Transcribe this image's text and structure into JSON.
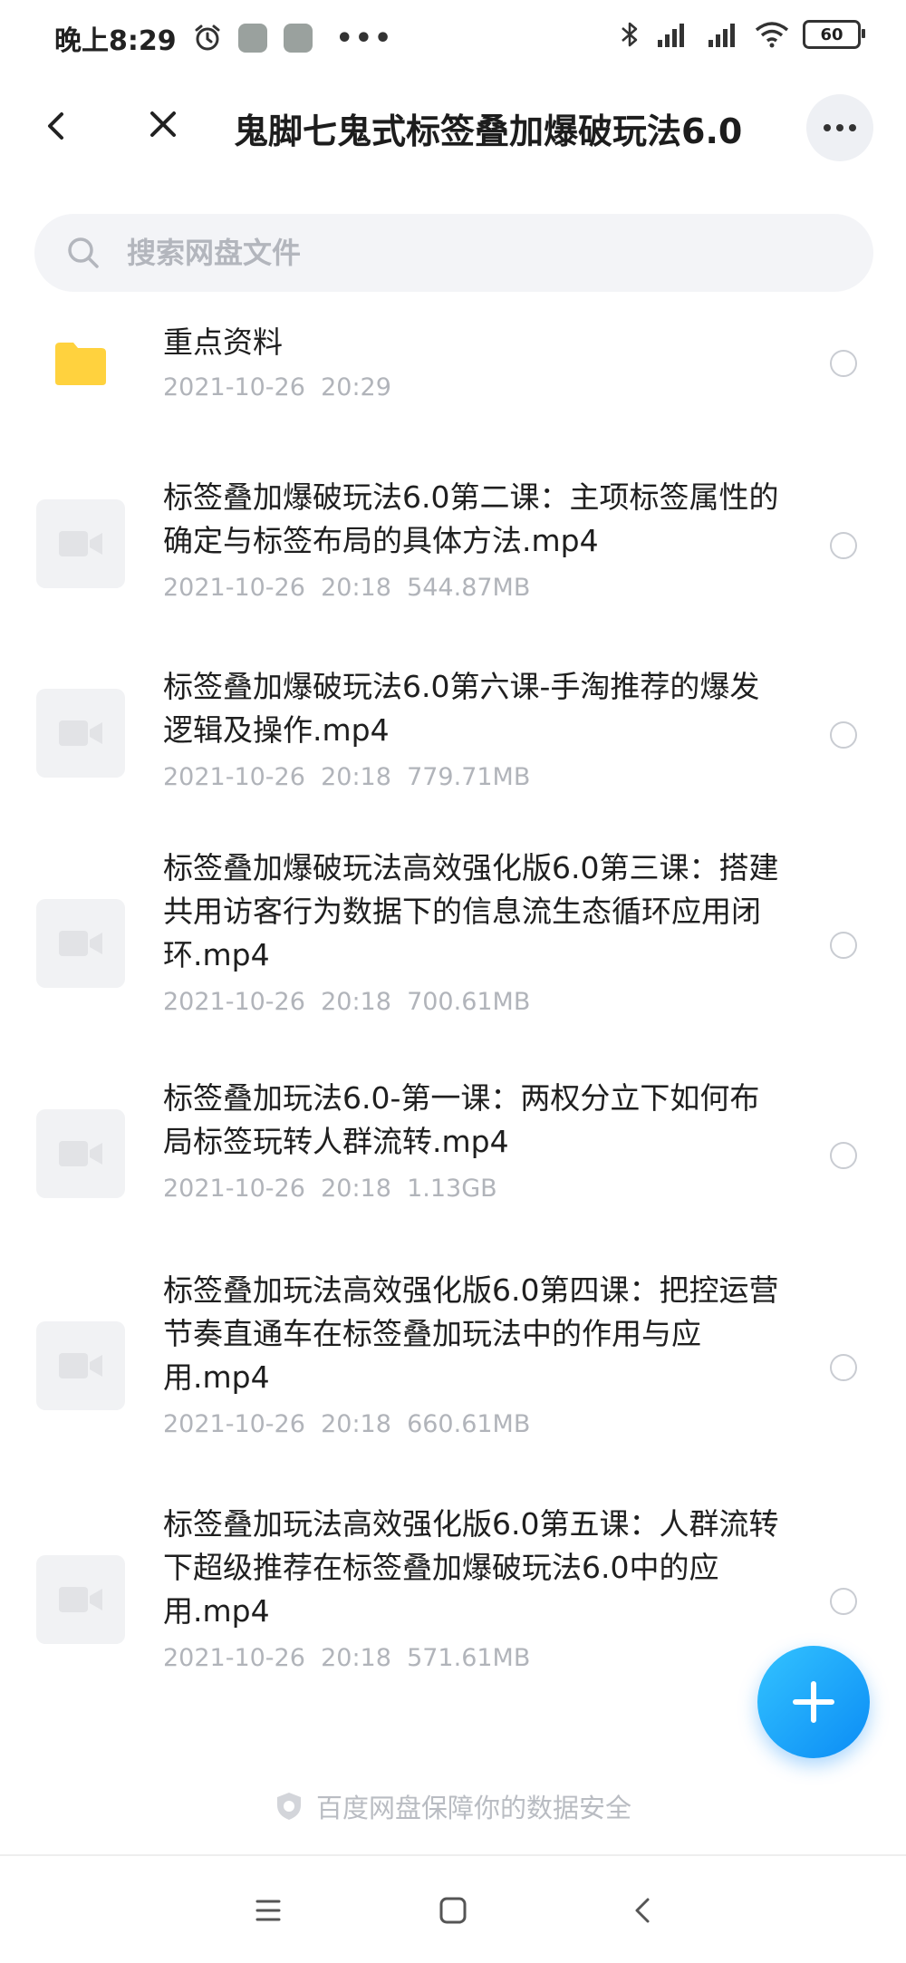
{
  "status_bar": {
    "time": "晚上8:29",
    "dots": "•••",
    "battery": "60",
    "icons": [
      "alarm-icon",
      "wechat-icon",
      "wechat-icon",
      "bluetooth-icon",
      "signal-hd-icon",
      "signal-hd-icon",
      "wifi-icon",
      "battery-icon"
    ]
  },
  "header": {
    "title": "鬼脚七鬼式标签叠加爆破玩法6.0"
  },
  "search": {
    "placeholder": "搜索网盘文件"
  },
  "files": [
    {
      "type": "folder",
      "name": "重点资料",
      "date": "2021-10-26",
      "time": "20:29",
      "size": ""
    },
    {
      "type": "video",
      "name": "标签叠加爆破玩法6.0第二课：主项标签属性的确定与标签布局的具体方法.mp4",
      "date": "2021-10-26",
      "time": "20:18",
      "size": "544.87MB"
    },
    {
      "type": "video",
      "name": "标签叠加爆破玩法6.0第六课-手淘推荐的爆发逻辑及操作.mp4",
      "date": "2021-10-26",
      "time": "20:18",
      "size": "779.71MB"
    },
    {
      "type": "video",
      "name": "标签叠加爆破玩法高效强化版6.0第三课：搭建共用访客行为数据下的信息流生态循环应用闭环.mp4",
      "date": "2021-10-26",
      "time": "20:18",
      "size": "700.61MB"
    },
    {
      "type": "video",
      "name": "标签叠加玩法6.0-第一课：两权分立下如何布局标签玩转人群流转.mp4",
      "date": "2021-10-26",
      "time": "20:18",
      "size": "1.13GB"
    },
    {
      "type": "video",
      "name": "标签叠加玩法高效强化版6.0第四课：把控运营节奏直通车在标签叠加玩法中的作用与应用.mp4",
      "date": "2021-10-26",
      "time": "20:18",
      "size": "660.61MB"
    },
    {
      "type": "video",
      "name": "标签叠加玩法高效强化版6.0第五课：人群流转下超级推荐在标签叠加爆破玩法6.0中的应用.mp4",
      "date": "2021-10-26",
      "time": "20:18",
      "size": "571.61MB"
    }
  ],
  "footer": {
    "safety_text": "百度网盘保障你的数据安全"
  },
  "colors": {
    "accent": "#0b8cf5",
    "folder": "#ffd23e",
    "muted_text": "#b1b4ba"
  }
}
